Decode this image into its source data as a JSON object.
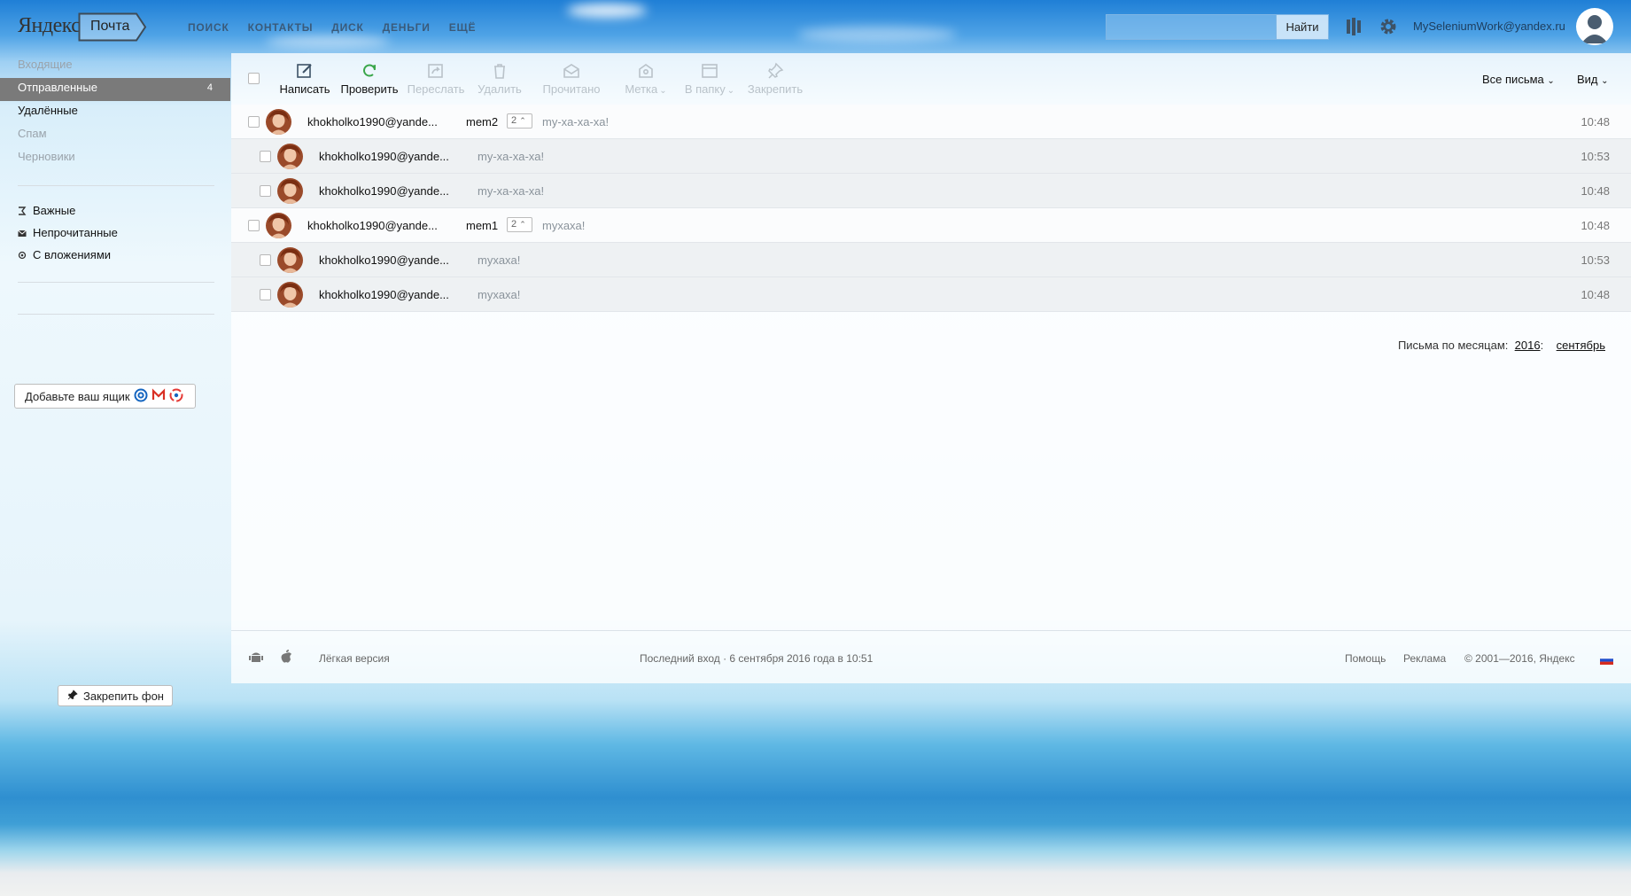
{
  "header": {
    "logo_yandex": "Яндекс",
    "logo_pochta": "Почта",
    "nav": [
      "ПОИСК",
      "КОНТАКТЫ",
      "ДИСК",
      "ДЕНЬГИ",
      "ЕЩЁ"
    ],
    "search_placeholder": "",
    "search_button": "Найти",
    "user_email": "MySeleniumWork@yandex.ru"
  },
  "sidebar": {
    "folders": [
      {
        "label": "Входящие",
        "count": ""
      },
      {
        "label": "Отправленные",
        "count": "4"
      },
      {
        "label": "Удалённые",
        "count": ""
      },
      {
        "label": "Спам",
        "count": ""
      },
      {
        "label": "Черновики",
        "count": ""
      }
    ],
    "filters": [
      "Важные",
      "Непрочитанные",
      "С вложениями"
    ],
    "add_mailbox": "Добавьте ваш ящик",
    "pin_background": "Закрепить фон"
  },
  "toolbar": {
    "buttons": [
      {
        "label": "Написать",
        "icon": "compose-icon",
        "enabled": true
      },
      {
        "label": "Проверить",
        "icon": "refresh-icon",
        "enabled": true
      },
      {
        "label": "Переслать",
        "icon": "forward-icon",
        "enabled": false
      },
      {
        "label": "Удалить",
        "icon": "trash-icon",
        "enabled": false
      },
      {
        "label": "Прочитано",
        "icon": "envelope-open-icon",
        "enabled": false
      },
      {
        "label": "Метка",
        "icon": "tag-icon",
        "enabled": false
      },
      {
        "label": "В папку",
        "icon": "folder-icon",
        "enabled": false
      },
      {
        "label": "Закрепить",
        "icon": "pin-icon",
        "enabled": false
      }
    ],
    "all_letters": "Все письма",
    "view": "Вид"
  },
  "messages": [
    {
      "from": "khokholko1990@yande...",
      "subject": "mem2",
      "thread_count": "2",
      "snippet": "my-xa-xa-xa!",
      "time": "10:48",
      "child": false
    },
    {
      "from": "khokholko1990@yande...",
      "subject": "",
      "thread_count": "",
      "snippet": "my-xa-xa-xa!",
      "time": "10:53",
      "child": true
    },
    {
      "from": "khokholko1990@yande...",
      "subject": "",
      "thread_count": "",
      "snippet": "my-xa-xa-xa!",
      "time": "10:48",
      "child": true
    },
    {
      "from": "khokholko1990@yande...",
      "subject": "mem1",
      "thread_count": "2",
      "snippet": "myxaxa!",
      "time": "10:48",
      "child": false
    },
    {
      "from": "khokholko1990@yande...",
      "subject": "",
      "thread_count": "",
      "snippet": "myxaxa!",
      "time": "10:53",
      "child": true
    },
    {
      "from": "khokholko1990@yande...",
      "subject": "",
      "thread_count": "",
      "snippet": "myxaxa!",
      "time": "10:48",
      "child": true
    }
  ],
  "months": {
    "label": "Письма по месяцам:",
    "year": "2016",
    "month": "сентябрь"
  },
  "footer": {
    "light_version": "Лёгкая версия",
    "last_login": "Последний вход · 6 сентября 2016 года в 10:51",
    "help": "Помощь",
    "ads": "Реклама",
    "copyright": "© 2001—2016, Яндекс"
  },
  "colors": {
    "active_folder_bg": "#7a7a7a",
    "refresh_icon": "#3aa64a",
    "disabled_text": "#b9c2c9"
  }
}
